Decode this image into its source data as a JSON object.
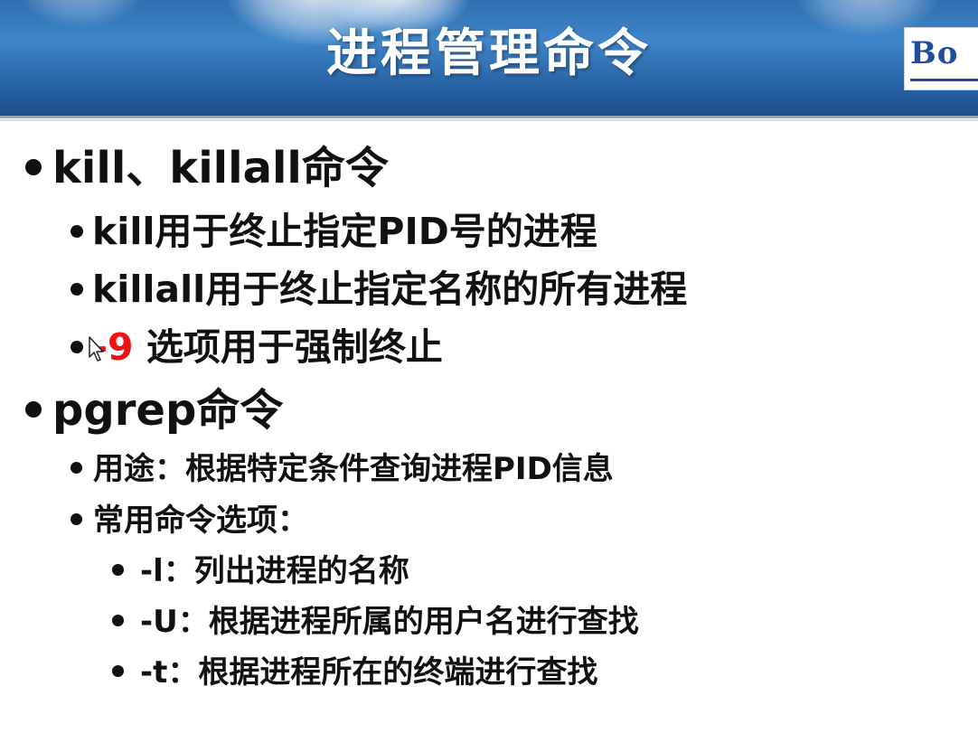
{
  "header": {
    "title": "进程管理命令",
    "logo_text": "Bo"
  },
  "section1": {
    "heading": "kill、killall命令",
    "items": [
      {
        "text": "kill用于终止指定PID号的进程"
      },
      {
        "text": "killall用于终止指定名称的所有进程"
      },
      {
        "option": "-9",
        "text": " 选项用于强制终止"
      }
    ]
  },
  "section2": {
    "heading": "pgrep命令",
    "items": [
      {
        "text": "用途：根据特定条件查询进程PID信息"
      },
      {
        "text": "常用命令选项："
      }
    ],
    "options": [
      {
        "text": "-l：列出进程的名称"
      },
      {
        "text": "-U：根据进程所属的用户名进行查找"
      },
      {
        "text": "-t：根据进程所在的终端进行查找"
      }
    ]
  },
  "colors": {
    "header_blue": "#2f6fb0",
    "highlight_red": "#ee1111",
    "logo_blue": "#1f4f9c"
  }
}
